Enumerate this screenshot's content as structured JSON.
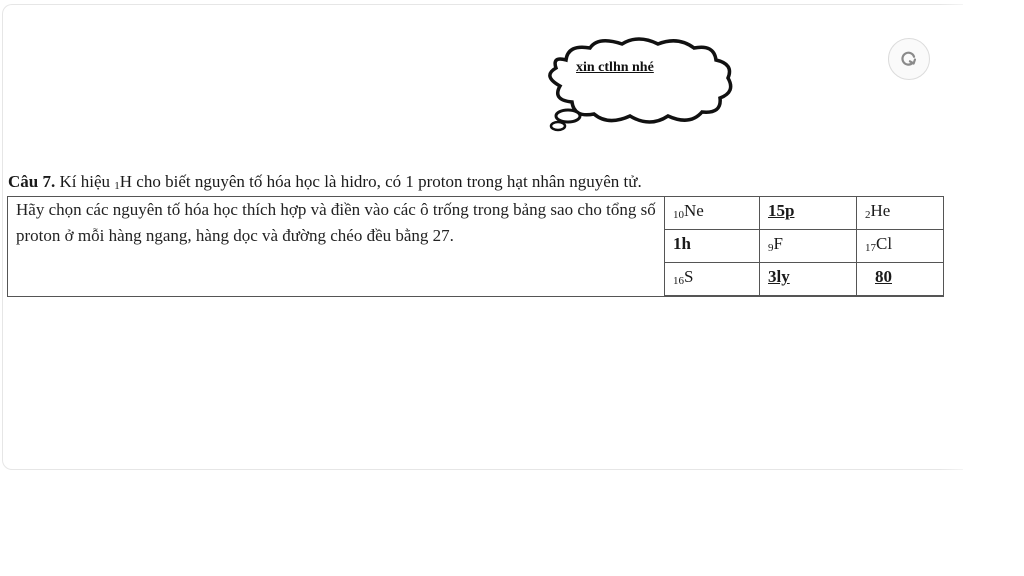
{
  "bubble": {
    "text": "xin ctlhn nhé"
  },
  "question": {
    "label": "Câu 7.",
    "text_before": " Kí hiệu ",
    "h_prefix": "1",
    "h_symbol": "H",
    "text_after": " cho biết nguyên tố hóa học là hidro, có 1 proton trong hạt nhân nguyên tử."
  },
  "table": {
    "prompt": "Hãy chọn các nguyên tố hóa học thích hợp và điền vào các ô trống trong bảng sao cho tổng số proton ở mỗi hàng ngang, hàng dọc và đường chéo đều bằng 27.",
    "rows": [
      [
        {
          "pre": "10",
          "sym": "Ne"
        },
        {
          "answer": "15p"
        },
        {
          "pre": "2",
          "sym": "He"
        }
      ],
      [
        {
          "answer": "1h"
        },
        {
          "pre": "9",
          "sym": "F"
        },
        {
          "pre": "17",
          "sym": "Cl"
        }
      ],
      [
        {
          "pre": "16",
          "sym": "S"
        },
        {
          "answer": "3ly"
        },
        {
          "answer": "80"
        }
      ]
    ]
  },
  "icons": {
    "refresh": "refresh-icon"
  },
  "colors": {
    "border": "#555555",
    "card_border": "#e6e6e6"
  }
}
